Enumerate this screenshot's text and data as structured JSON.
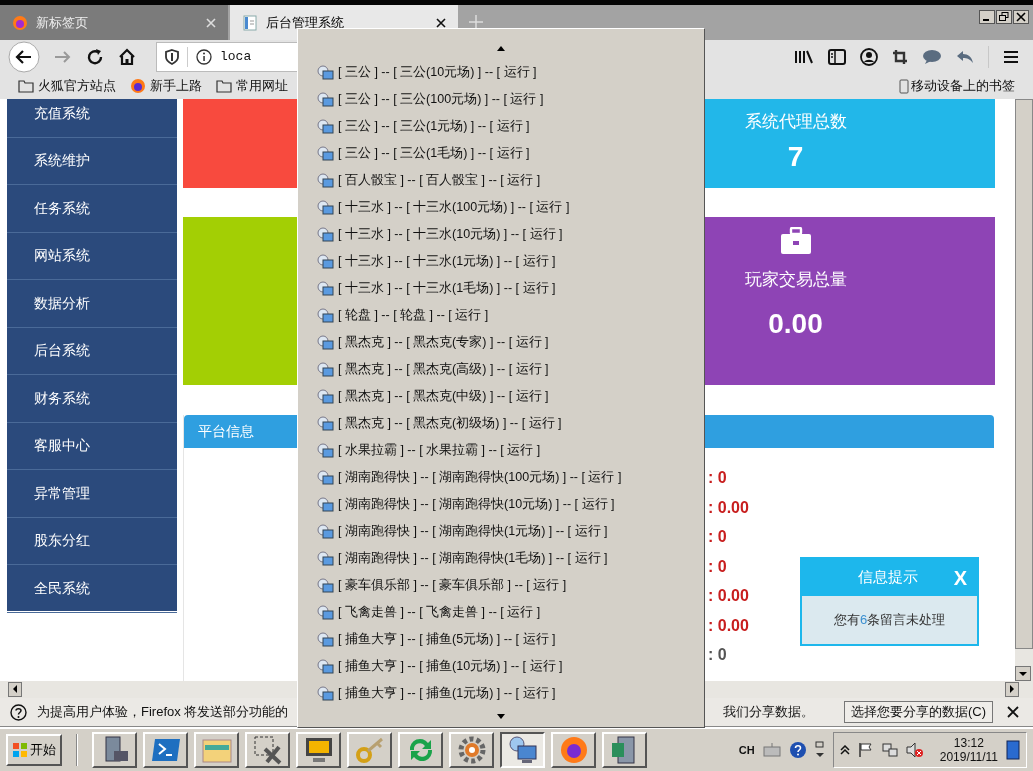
{
  "browser": {
    "tabs": [
      {
        "title": "新标签页",
        "selected": false
      },
      {
        "title": "后台管理系统",
        "selected": true
      }
    ],
    "address": "loca",
    "bookmarks": [
      {
        "label": "火狐官方站点",
        "kind": "folder"
      },
      {
        "label": "新手上路",
        "kind": "firefox"
      },
      {
        "label": "常用网址",
        "kind": "folder"
      }
    ],
    "mobile_bookmarks": "移动设备上的书签"
  },
  "sidebar": {
    "items": [
      "充值系统",
      "系统维护",
      "任务系统",
      "网站系统",
      "数据分析",
      "后台系统",
      "财务系统",
      "客服中心",
      "异常管理",
      "股东分红",
      "全民系统"
    ]
  },
  "cards": [
    {
      "color": "#f84a3e",
      "kind": "plain"
    },
    {
      "color": "#22b7e9",
      "label": "系统代理总数",
      "value": "7",
      "kind": "stat"
    },
    {
      "color": "#a3cf04",
      "kind": "plain"
    },
    {
      "color": "#8e44b5",
      "label": "玩家交易总量",
      "value": "0.00",
      "kind": "briefcase"
    }
  ],
  "platform_info": {
    "title": "平台信息",
    "values": [
      {
        "text": ": 0",
        "highlight": true
      },
      {
        "text": ": 0.00",
        "highlight": true
      },
      {
        "text": ": 0",
        "highlight": true
      },
      {
        "text": ": 0",
        "highlight": true
      },
      {
        "text": ": 0.00",
        "highlight": true
      },
      {
        "text": ": 0.00",
        "highlight": true
      },
      {
        "text": ": 0",
        "highlight": false
      }
    ]
  },
  "popup": {
    "title": "信息提示",
    "close": "X",
    "message_before": "您有",
    "count": "6",
    "message_after": "条留言未处理"
  },
  "dropdown": {
    "items": [
      "[ 三公 ] -- [ 三公(10元场) ] -- [ 运行 ]",
      "[ 三公 ] -- [ 三公(100元场) ] -- [ 运行 ]",
      "[ 三公 ] -- [ 三公(1元场) ] -- [ 运行 ]",
      "[ 三公 ] -- [ 三公(1毛场) ] -- [ 运行 ]",
      "[ 百人骰宝 ] -- [ 百人骰宝 ] -- [ 运行 ]",
      "[ 十三水 ] -- [ 十三水(100元场) ] -- [ 运行 ]",
      "[ 十三水 ] -- [ 十三水(10元场) ] -- [ 运行 ]",
      "[ 十三水 ] -- [ 十三水(1元场) ] -- [ 运行 ]",
      "[ 十三水 ] -- [ 十三水(1毛场) ] -- [ 运行 ]",
      "[ 轮盘 ] -- [ 轮盘 ] -- [ 运行 ]",
      "[ 黑杰克 ] -- [ 黑杰克(专家) ] -- [ 运行 ]",
      "[ 黑杰克 ] -- [ 黑杰克(高级) ] -- [ 运行 ]",
      "[ 黑杰克 ] -- [ 黑杰克(中级) ] -- [ 运行 ]",
      "[ 黑杰克 ] -- [ 黑杰克(初级场) ] -- [ 运行 ]",
      "[ 水果拉霸 ] -- [ 水果拉霸 ] -- [ 运行 ]",
      "[ 湖南跑得快 ] -- [ 湖南跑得快(100元场) ] -- [ 运行 ]",
      "[ 湖南跑得快 ] -- [ 湖南跑得快(10元场) ] -- [ 运行 ]",
      "[ 湖南跑得快 ] -- [ 湖南跑得快(1元场) ] -- [ 运行 ]",
      "[ 湖南跑得快 ] -- [ 湖南跑得快(1毛场) ] -- [ 运行 ]",
      "[ 豪车俱乐部 ] -- [ 豪车俱乐部 ] -- [ 运行 ]",
      "[ 飞禽走兽 ] -- [ 飞禽走兽 ] -- [ 运行 ]",
      "[ 捕鱼大亨 ] -- [ 捕鱼(5元场) ] -- [ 运行 ]",
      "[ 捕鱼大亨 ] -- [ 捕鱼(10元场) ] -- [ 运行 ]",
      "[ 捕鱼大亨 ] -- [ 捕鱼(1元场) ] -- [ 运行 ]"
    ]
  },
  "notification": {
    "text_left": "为提高用户体验，Firefox 将发送部分功能的",
    "text_right": "我们分享数据。",
    "button": "选择您要分享的数据(C)"
  },
  "taskbar": {
    "start": "开始",
    "apps": [
      {
        "kind": "server-tools",
        "selected": false
      },
      {
        "kind": "terminal",
        "selected": false
      },
      {
        "kind": "folder",
        "selected": false
      },
      {
        "kind": "tools",
        "selected": false
      },
      {
        "kind": "monitor",
        "selected": false
      },
      {
        "kind": "key",
        "selected": false
      },
      {
        "kind": "arrows",
        "selected": false
      },
      {
        "kind": "gear",
        "selected": false
      },
      {
        "kind": "network",
        "selected": true
      },
      {
        "kind": "firefox",
        "selected": false
      },
      {
        "kind": "server",
        "selected": false
      }
    ],
    "language": "CH",
    "time": "13:12",
    "date": "2019/11/11"
  }
}
